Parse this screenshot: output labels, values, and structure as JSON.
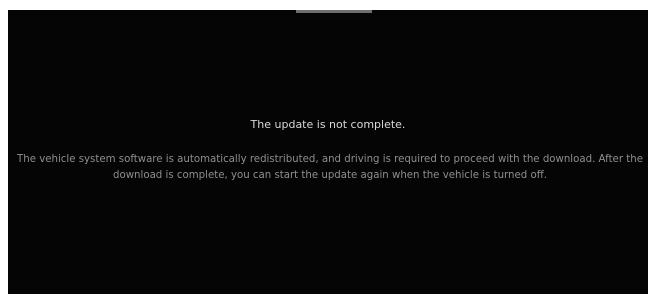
{
  "dialog": {
    "title": "The update is not complete.",
    "message": "The vehicle system software is automatically redistributed, and driving is required to proceed with the download. After the download is complete, you can start the update again when the vehicle is turned off."
  }
}
